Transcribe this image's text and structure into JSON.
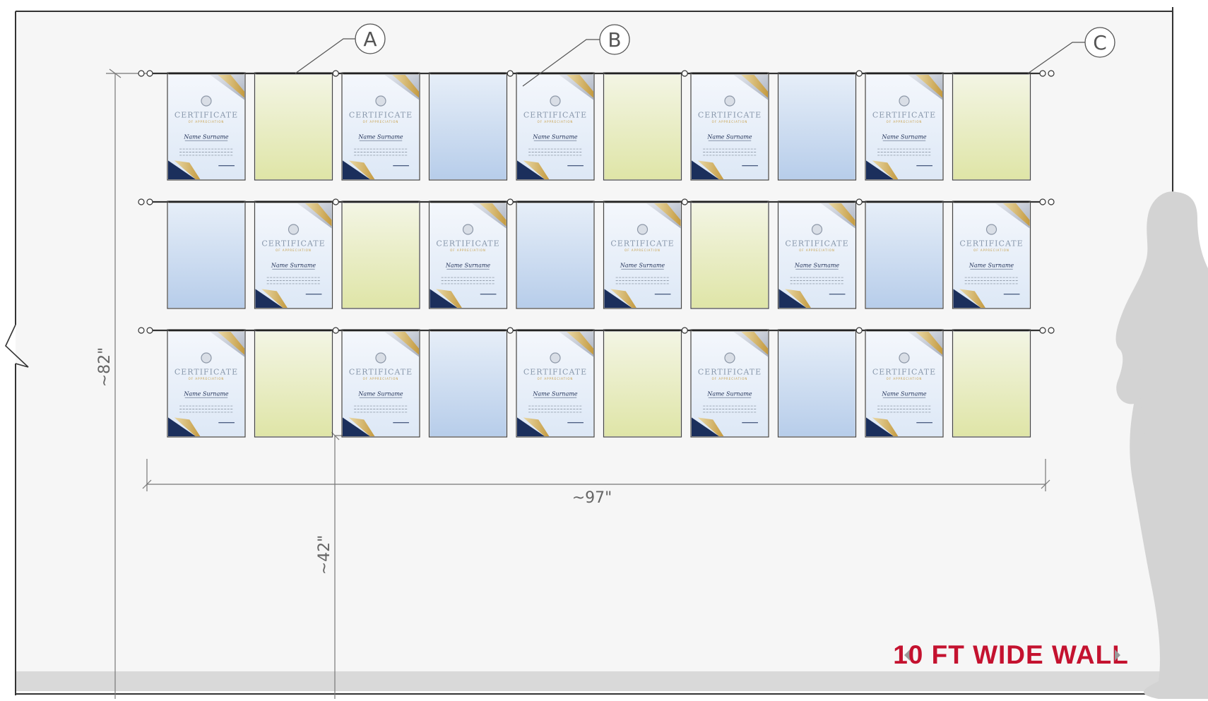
{
  "wall": {
    "banner_text": "10 FT WIDE WALL",
    "colors": {
      "wall": "#f6f6f6",
      "floor": "#d9d9d9",
      "banner": "#c4122f",
      "silhouette": "#d3d3d3",
      "rail": "#333333",
      "frame_yellow_top": "#f3f5e4",
      "frame_yellow_bottom": "#dfe5a7",
      "frame_blue_top": "#e6eef8",
      "frame_blue_bottom": "#b7cdea",
      "cert_navy": "#1b2f5c",
      "cert_gold": "#d4b15f"
    }
  },
  "callouts": [
    "A",
    "B",
    "C"
  ],
  "dimensions": {
    "height": "~82\"",
    "width": "~97\"",
    "bottom_height": "~42\""
  },
  "certificate": {
    "title": "CERTIFICATE",
    "subtitle": "OF APPRECIATION",
    "name": "Name Surname"
  },
  "rows": [
    [
      "certificate",
      "yellow",
      "certificate",
      "blue",
      "certificate",
      "yellow",
      "certificate",
      "blue",
      "certificate",
      "yellow"
    ],
    [
      "blue",
      "certificate",
      "yellow",
      "certificate",
      "blue",
      "certificate",
      "yellow",
      "certificate",
      "blue",
      "certificate"
    ],
    [
      "certificate",
      "yellow",
      "certificate",
      "blue",
      "certificate",
      "yellow",
      "certificate",
      "blue",
      "certificate",
      "yellow"
    ]
  ]
}
